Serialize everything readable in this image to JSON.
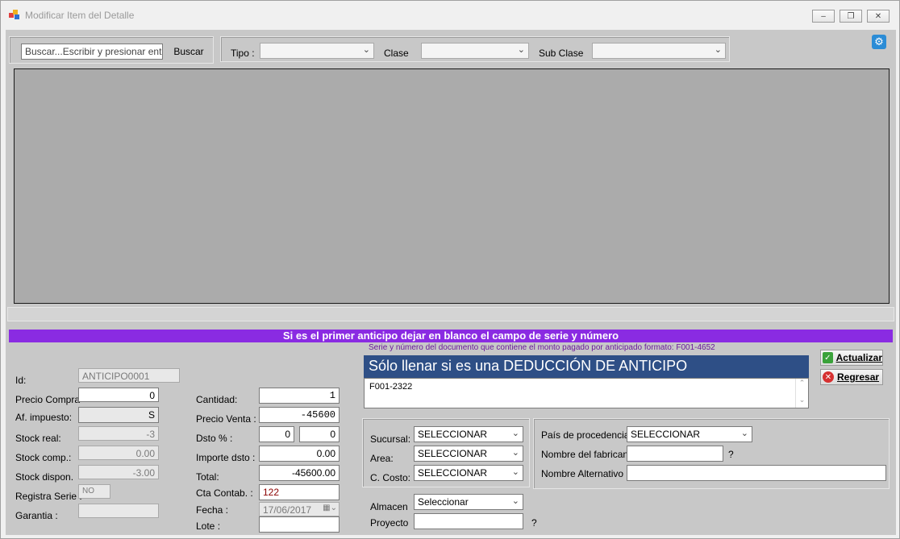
{
  "window": {
    "title": "Modificar Item del Detalle",
    "controls": [
      "minimize",
      "restore",
      "close"
    ]
  },
  "search": {
    "placeholder": "Buscar...Escribir y presionar enter",
    "button_label": "Buscar"
  },
  "filters": {
    "tipo_label": "Tipo :",
    "tipo_value": "",
    "clase_label": "Clase",
    "clase_value": "",
    "subclase_label": "Sub Clase",
    "subclase_value": ""
  },
  "banner": "Si es el primer anticipo dejar en blanco el campo de serie y número",
  "deduction": {
    "caption": "Serie y número del documento que contiene el monto pagado por anticipado formato: F001-4652",
    "header": "Sólo llenar si es una DEDUCCIÓN DE ANTICIPO",
    "value": "F001-2322"
  },
  "actions": {
    "update_label": "Actualizar",
    "back_label": "Regresar"
  },
  "left_fields": {
    "id_label": "Id:",
    "id_value": "ANTICIPO0001",
    "precio_compra_label": "Precio Compra",
    "precio_compra_value": "0",
    "af_impuesto_label": "Af. impuesto:",
    "af_impuesto_value": "S",
    "stock_real_label": "Stock real:",
    "stock_real_value": "-3",
    "stock_comp_label": "Stock comp.:",
    "stock_comp_value": "0.00",
    "stock_dispon_label": "Stock dispon.",
    "stock_dispon_value": "-3.00",
    "registra_serie_label": "Registra Serie :",
    "registra_serie_value": "NO",
    "garantia_label": "Garantia :",
    "garantia_value": ""
  },
  "mid_fields": {
    "cantidad_label": "Cantidad:",
    "cantidad_value": "1",
    "precio_venta_label": "Precio Venta :",
    "precio_venta_value": "-45600",
    "dsto_label": "Dsto % :",
    "dsto_value_1": "0",
    "dsto_value_2": "0",
    "importe_dsto_label": "Importe dsto :",
    "importe_dsto_value": "0.00",
    "total_label": "Total:",
    "total_value": "-45600.00",
    "cta_contab_label": "Cta Contab. :",
    "cta_contab_value": "122",
    "fecha_label": "Fecha :",
    "fecha_value": "17/06/2017",
    "lote_label": "Lote :",
    "lote_value": ""
  },
  "cost_fields": {
    "sucursal_label": "Sucursal:",
    "sucursal_value": "SELECCIONAR",
    "area_label": "Area:",
    "area_value": "SELECCIONAR",
    "ccosto_label": "C. Costo:",
    "ccosto_value": "SELECCIONAR",
    "almacen_label": "Almacen",
    "almacen_value": "Seleccionar",
    "proyecto_label": "Proyecto",
    "proyecto_value": "",
    "proyecto_help": "?"
  },
  "origin_fields": {
    "pais_label": "País de procedencia",
    "pais_value": "SELECCIONAR",
    "fabricante_label": "Nombre del fabricante",
    "fabricante_value": "",
    "fabricante_help": "?",
    "alternativo_label": "Nombre Alternativo",
    "alternativo_value": ""
  },
  "colors": {
    "banner": "#8a2be2",
    "header": "#2e4f86",
    "panel": "#c8c8c8",
    "grid": "#ababab"
  }
}
